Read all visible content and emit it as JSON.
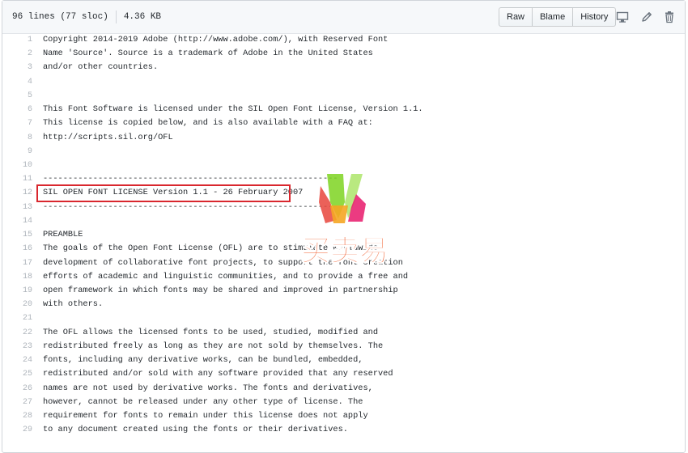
{
  "file": {
    "lines_info": "96 lines (77 sloc)",
    "size": "4.36 KB"
  },
  "toolbar": {
    "raw_label": "Raw",
    "blame_label": "Blame",
    "history_label": "History",
    "icons": [
      "desktop-icon",
      "pencil-icon",
      "trash-icon"
    ]
  },
  "code_lines": [
    {
      "n": "1",
      "text": "Copyright 2014-2019 Adobe (http://www.adobe.com/), with Reserved Font"
    },
    {
      "n": "2",
      "text": "Name 'Source'. Source is a trademark of Adobe in the United States"
    },
    {
      "n": "3",
      "text": "and/or other countries."
    },
    {
      "n": "4",
      "text": ""
    },
    {
      "n": "5",
      "text": ""
    },
    {
      "n": "6",
      "text": "This Font Software is licensed under the SIL Open Font License, Version 1.1."
    },
    {
      "n": "7",
      "text": "This license is copied below, and is also available with a FAQ at:"
    },
    {
      "n": "8",
      "text": "http://scripts.sil.org/OFL"
    },
    {
      "n": "9",
      "text": ""
    },
    {
      "n": "10",
      "text": ""
    },
    {
      "n": "11",
      "text": "-----------------------------------------------------------"
    },
    {
      "n": "12",
      "text": "SIL OPEN FONT LICENSE Version 1.1 - 26 February 2007"
    },
    {
      "n": "13",
      "text": "-----------------------------------------------------------"
    },
    {
      "n": "14",
      "text": ""
    },
    {
      "n": "15",
      "text": "PREAMBLE"
    },
    {
      "n": "16",
      "text": "The goals of the Open Font License (OFL) are to stimulate worldwide"
    },
    {
      "n": "17",
      "text": "development of collaborative font projects, to support the font creation"
    },
    {
      "n": "18",
      "text": "efforts of academic and linguistic communities, and to provide a free and"
    },
    {
      "n": "19",
      "text": "open framework in which fonts may be shared and improved in partnership"
    },
    {
      "n": "20",
      "text": "with others."
    },
    {
      "n": "21",
      "text": ""
    },
    {
      "n": "22",
      "text": "The OFL allows the licensed fonts to be used, studied, modified and"
    },
    {
      "n": "23",
      "text": "redistributed freely as long as they are not sold by themselves. The"
    },
    {
      "n": "24",
      "text": "fonts, including any derivative works, can be bundled, embedded,"
    },
    {
      "n": "25",
      "text": "redistributed and/or sold with any software provided that any reserved"
    },
    {
      "n": "26",
      "text": "names are not used by derivative works. The fonts and derivatives,"
    },
    {
      "n": "27",
      "text": "however, cannot be released under any other type of license. The"
    },
    {
      "n": "28",
      "text": "requirement for fonts to remain under this license does not apply"
    },
    {
      "n": "29",
      "text": "to any document created using the fonts or their derivatives."
    }
  ],
  "watermark": {
    "text": "买卖易",
    "colors": [
      "#e8453c",
      "#f5a623",
      "#7ed321",
      "#e8196b"
    ]
  },
  "colors": {
    "highlight_border": "#d9272e"
  }
}
